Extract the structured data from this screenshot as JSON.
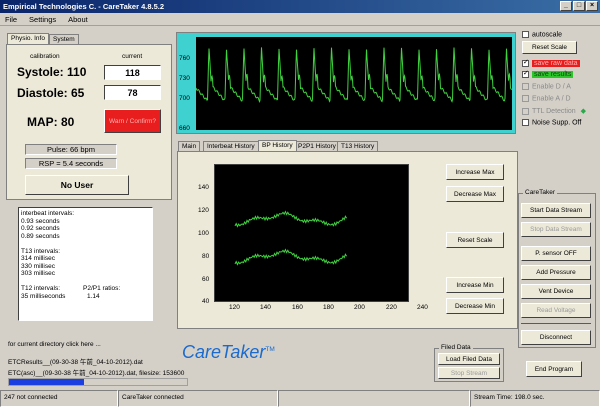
{
  "window": {
    "title": "Empirical Technologies C. -  CareTaker 4.8.5.2"
  },
  "menu": [
    "File",
    "Settings",
    "About"
  ],
  "left_tabs": [
    "Physio. Info",
    "System"
  ],
  "physio": {
    "calibration_label": "calibration",
    "current_label": "current",
    "systole_label": "Systole: 110",
    "systole_current": "118",
    "diastole_label": "Diastole: 65",
    "diastole_current": "78",
    "map_label": "MAP: 80",
    "warn_button": "Warn / Confirm?",
    "pulse": "Pulse: 66 bpm",
    "rsp": "RSP = 5.4 seconds",
    "user_button": "No User"
  },
  "info_text": {
    "lines": [
      "interbeat intervals:",
      "0.93 seconds",
      "0.92 seconds",
      "0.89 seconds",
      "",
      "T13 intervals:",
      "314 millisec",
      "330 millisec",
      "303 millisec",
      ""
    ],
    "t12_label": "T12 intervals:",
    "t12_value": "35 milliseconds",
    "p2p1_label": "P2/P1 ratios:",
    "p2p1_value": "1.14"
  },
  "waveform": {
    "y_ticks": [
      "760",
      "730",
      "700",
      "660"
    ],
    "colors": {
      "background": "#000000",
      "trace": "#3fd43f",
      "frame": "#3fd0d0"
    }
  },
  "center_tabs": [
    "Main",
    "Interbeat History",
    "BP History",
    "P2P1 History",
    "T13 History"
  ],
  "history_chart": {
    "y_ticks": [
      "140",
      "120",
      "100",
      "80",
      "60",
      "40"
    ],
    "x_ticks": [
      "120",
      "140",
      "160",
      "180",
      "200",
      "220",
      "240"
    ]
  },
  "chart_buttons": {
    "increase_max": "Increase Max",
    "decrease_max": "Decrease Max",
    "reset_scale": "Reset Scale",
    "increase_min": "Increase Min",
    "decrease_min": "Decrease Min"
  },
  "right_panel": {
    "autoscale": "autoscale",
    "reset_scale": "Reset Scale",
    "save_raw": "save raw data",
    "save_results": "save results",
    "enable_da": "Enable D / A",
    "enable_ad": "Enable A / D",
    "ttl_detection": "TTL Detection",
    "noise_supp": "Noise Supp. Off",
    "group_title": "CareTaker",
    "start_stream": "Start Data Stream",
    "stop_stream": "Stop Data Stream",
    "p_sensor": "P. sensor OFF",
    "add_pressure": "Add Pressure",
    "vent_device": "Vent Device",
    "read_voltage": "Read Voltage",
    "disconnect": "Disconnect",
    "end_program": "End Program"
  },
  "bottom": {
    "directory_link": "for current directory click here ...",
    "file1": "ETCResults__(09-30-38 午前_04-10-2012).dat",
    "file2": "ETC(asc)__(09-30-38 午前_04-10-2012).dat, filesize: 153600",
    "logo": "CareTaker",
    "logo_tm": "TM",
    "filed_data_title": "Filed Data",
    "load_filed": "Load Filed Data",
    "stop_stream": "Stop Stream",
    "progress": 0.42
  },
  "status": {
    "s1": "247 not connected",
    "s2": "CareTaker connected",
    "s3": "",
    "s4": "Stream Time: 198.0 sec."
  }
}
